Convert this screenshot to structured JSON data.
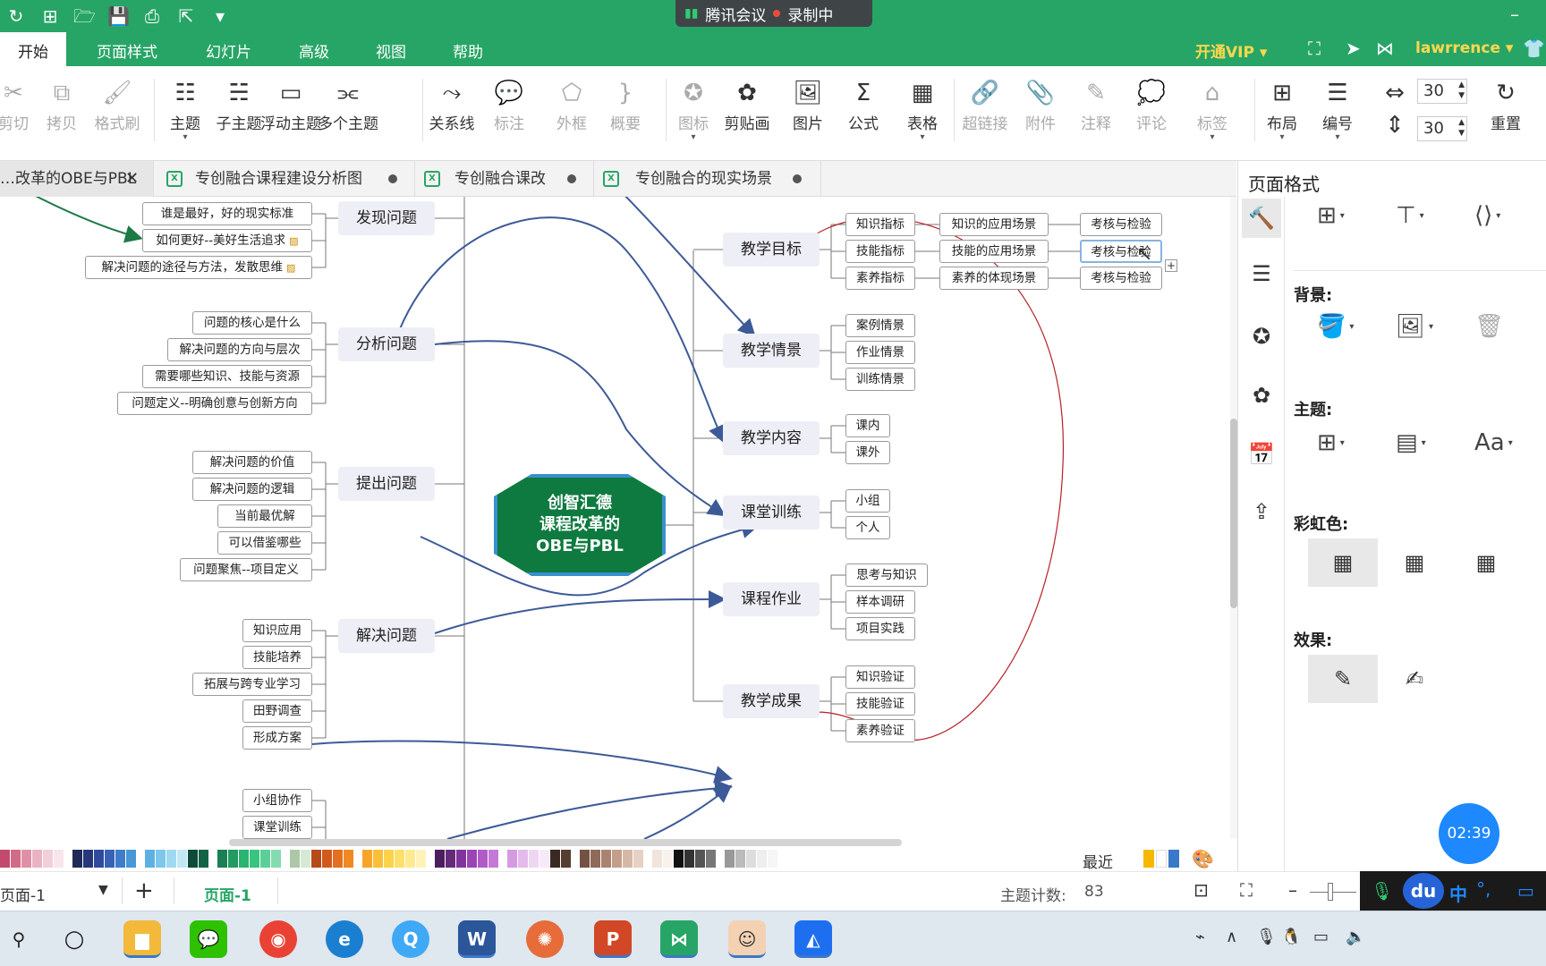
{
  "app": {
    "meeting_name": "腾讯会议",
    "recording_label": "录制中",
    "menu": [
      "开始",
      "页面样式",
      "幻灯片",
      "高级",
      "视图",
      "帮助"
    ],
    "vip_label": "开通VIP",
    "username": "lawrrence"
  },
  "ribbon": {
    "buttons": [
      {
        "label": "剪切",
        "icon": "scissors-icon",
        "glyph": "✂",
        "disabled": true
      },
      {
        "label": "拷贝",
        "icon": "copy-icon",
        "glyph": "⧉",
        "disabled": true
      },
      {
        "label": "格式刷",
        "icon": "format-brush-icon",
        "glyph": "🖌",
        "disabled": true
      },
      {
        "label": "主题",
        "icon": "topic-icon",
        "glyph": "☷",
        "disabled": false,
        "dropdown": true
      },
      {
        "label": "子主题",
        "icon": "subtopic-icon",
        "glyph": "☵",
        "disabled": false
      },
      {
        "label": "浮动主题",
        "icon": "floating-topic-icon",
        "glyph": "▭",
        "disabled": false
      },
      {
        "label": "多个主题",
        "icon": "multi-topic-icon",
        "glyph": "⫘",
        "disabled": false
      },
      {
        "label": "关系线",
        "icon": "relation-line-icon",
        "glyph": "⤳",
        "disabled": false
      },
      {
        "label": "标注",
        "icon": "callout-icon",
        "glyph": "💬",
        "disabled": true
      },
      {
        "label": "外框",
        "icon": "boundary-icon",
        "glyph": "⬠",
        "disabled": true
      },
      {
        "label": "概要",
        "icon": "summary-icon",
        "glyph": "}",
        "disabled": true
      },
      {
        "label": "图标",
        "icon": "marker-icon",
        "glyph": "✪",
        "disabled": true,
        "dropdown": true
      },
      {
        "label": "剪贴画",
        "icon": "clipart-icon",
        "glyph": "✿",
        "disabled": false
      },
      {
        "label": "图片",
        "icon": "image-icon",
        "glyph": "🖼",
        "disabled": false
      },
      {
        "label": "公式",
        "icon": "formula-icon",
        "glyph": "Σ",
        "disabled": false
      },
      {
        "label": "表格",
        "icon": "table-icon",
        "glyph": "▦",
        "disabled": false,
        "dropdown": true
      },
      {
        "label": "超链接",
        "icon": "hyperlink-icon",
        "glyph": "🔗",
        "disabled": true
      },
      {
        "label": "附件",
        "icon": "attachment-icon",
        "glyph": "📎",
        "disabled": true
      },
      {
        "label": "注释",
        "icon": "note-icon",
        "glyph": "✎",
        "disabled": true
      },
      {
        "label": "评论",
        "icon": "comment-icon",
        "glyph": "💭",
        "disabled": true
      },
      {
        "label": "标签",
        "icon": "tag-icon",
        "glyph": "⌂",
        "disabled": true,
        "dropdown": true
      },
      {
        "label": "布局",
        "icon": "layout-icon",
        "glyph": "⊞",
        "disabled": false,
        "dropdown": true
      },
      {
        "label": "编号",
        "icon": "numbering-icon",
        "glyph": "☰",
        "disabled": false,
        "dropdown": true
      },
      {
        "label": "重置",
        "icon": "reset-icon",
        "glyph": "↻",
        "disabled": false
      }
    ],
    "spacing_h": "30",
    "spacing_v": "30"
  },
  "tabs": [
    {
      "label": "…改革的OBE与PBL",
      "active": true,
      "closable": true
    },
    {
      "label": "专创融合课程建设分析图",
      "active": false
    },
    {
      "label": "专创融合课改",
      "active": false
    },
    {
      "label": "专创融合的现实场景",
      "active": false
    }
  ],
  "mindmap": {
    "center": [
      "创智汇德",
      "课程改革的",
      "OBE与PBL"
    ],
    "left_topics": [
      "发现问题",
      "分析问题",
      "提出问题",
      "解决问题"
    ],
    "left_details": {
      "发现问题": [
        "谁是最好，好的现实标准",
        "如何更好--美好生活追求",
        "解决问题的途径与方法，发散思维"
      ],
      "分析问题": [
        "问题的核心是什么",
        "解决问题的方向与层次",
        "需要哪些知识、技能与资源",
        "问题定义--明确创意与创新方向"
      ],
      "提出问题": [
        "解决问题的价值",
        "解决问题的逻辑",
        "当前最优解",
        "可以借鉴哪些",
        "问题聚焦--项目定义"
      ],
      "解决问题": [
        "知识应用",
        "技能培养",
        "拓展与跨专业学习",
        "田野调查",
        "形成方案"
      ],
      "extra": [
        "小组协作",
        "课堂训练"
      ]
    },
    "right_topics": [
      "教学目标",
      "教学情景",
      "教学内容",
      "课堂训练",
      "课程作业",
      "教学成果"
    ],
    "goal_rows": [
      [
        "知识指标",
        "知识的应用场景",
        "考核与检验"
      ],
      [
        "技能指标",
        "技能的应用场景",
        "考核与检验"
      ],
      [
        "素养指标",
        "素养的体现场景",
        "考核与检验"
      ]
    ],
    "scene_subs": [
      "案例情景",
      "作业情景",
      "训练情景"
    ],
    "content_subs": [
      "课内",
      "课外"
    ],
    "training_subs": [
      "小组",
      "个人"
    ],
    "homework_subs": [
      "思考与知识",
      "样本调研",
      "项目实践"
    ],
    "result_subs": [
      "知识验证",
      "技能验证",
      "素养验证"
    ]
  },
  "palette": {
    "colors": [
      "#c34a6e",
      "#d26b86",
      "#e090a6",
      "#eab3c2",
      "#f1cfd8",
      "#f7e6eb",
      "#1f2a57",
      "#27377a",
      "#2f4a9a",
      "#3762b5",
      "#3f7cc9",
      "#4a97d8",
      "#5fb0e2",
      "#7cc7ea",
      "#9fd9f1",
      "#c2e8f6",
      "#0e4a3a",
      "#136447",
      "#1b7f55",
      "#229a62",
      "#2ab470",
      "#39c47f",
      "#5ccf98",
      "#84dbb2",
      "#acc8a8",
      "#d5e9d4",
      "#b64a1a",
      "#d05a1c",
      "#e36f1f",
      "#ef8a23",
      "#f6a52a",
      "#f9bf37",
      "#fbd24a",
      "#fde06a",
      "#feea91",
      "#fff2b9",
      "#4b1f5c",
      "#652a7a",
      "#80359a",
      "#9a45b5",
      "#b05bc8",
      "#c479d6",
      "#d59ae1",
      "#e3bbeb",
      "#efd6f3",
      "#f6e9f8",
      "#3a2a22",
      "#563d31",
      "#735244",
      "#8f6a58",
      "#a98370",
      "#c29e8b",
      "#d6b8a7",
      "#e6d1c4",
      "#f1e4db",
      "#f8f1ec",
      "#111111",
      "#333333",
      "#555555",
      "#777777",
      "#999999",
      "#bbbbbb",
      "#dddddd",
      "#eeeeee",
      "#f6f6f6",
      "#ffffff"
    ],
    "recent_label": "最近",
    "recent_colors": [
      "#f5b800",
      "#ffffff",
      "#3a78c8"
    ]
  },
  "status": {
    "sheet_select": "页面-1",
    "page_tab": "页面-1",
    "topic_count_label": "主题计数:",
    "topic_count": "83"
  },
  "panel": {
    "title": "页面格式",
    "background_label": "背景:",
    "theme_label": "主题:",
    "rainbow_label": "彩虹色:",
    "effect_label": "效果:",
    "theme_font_glyph": "Aa"
  },
  "timer": "02:39",
  "ime": {
    "brand": "du",
    "lang": "中",
    "punct": "°,"
  }
}
